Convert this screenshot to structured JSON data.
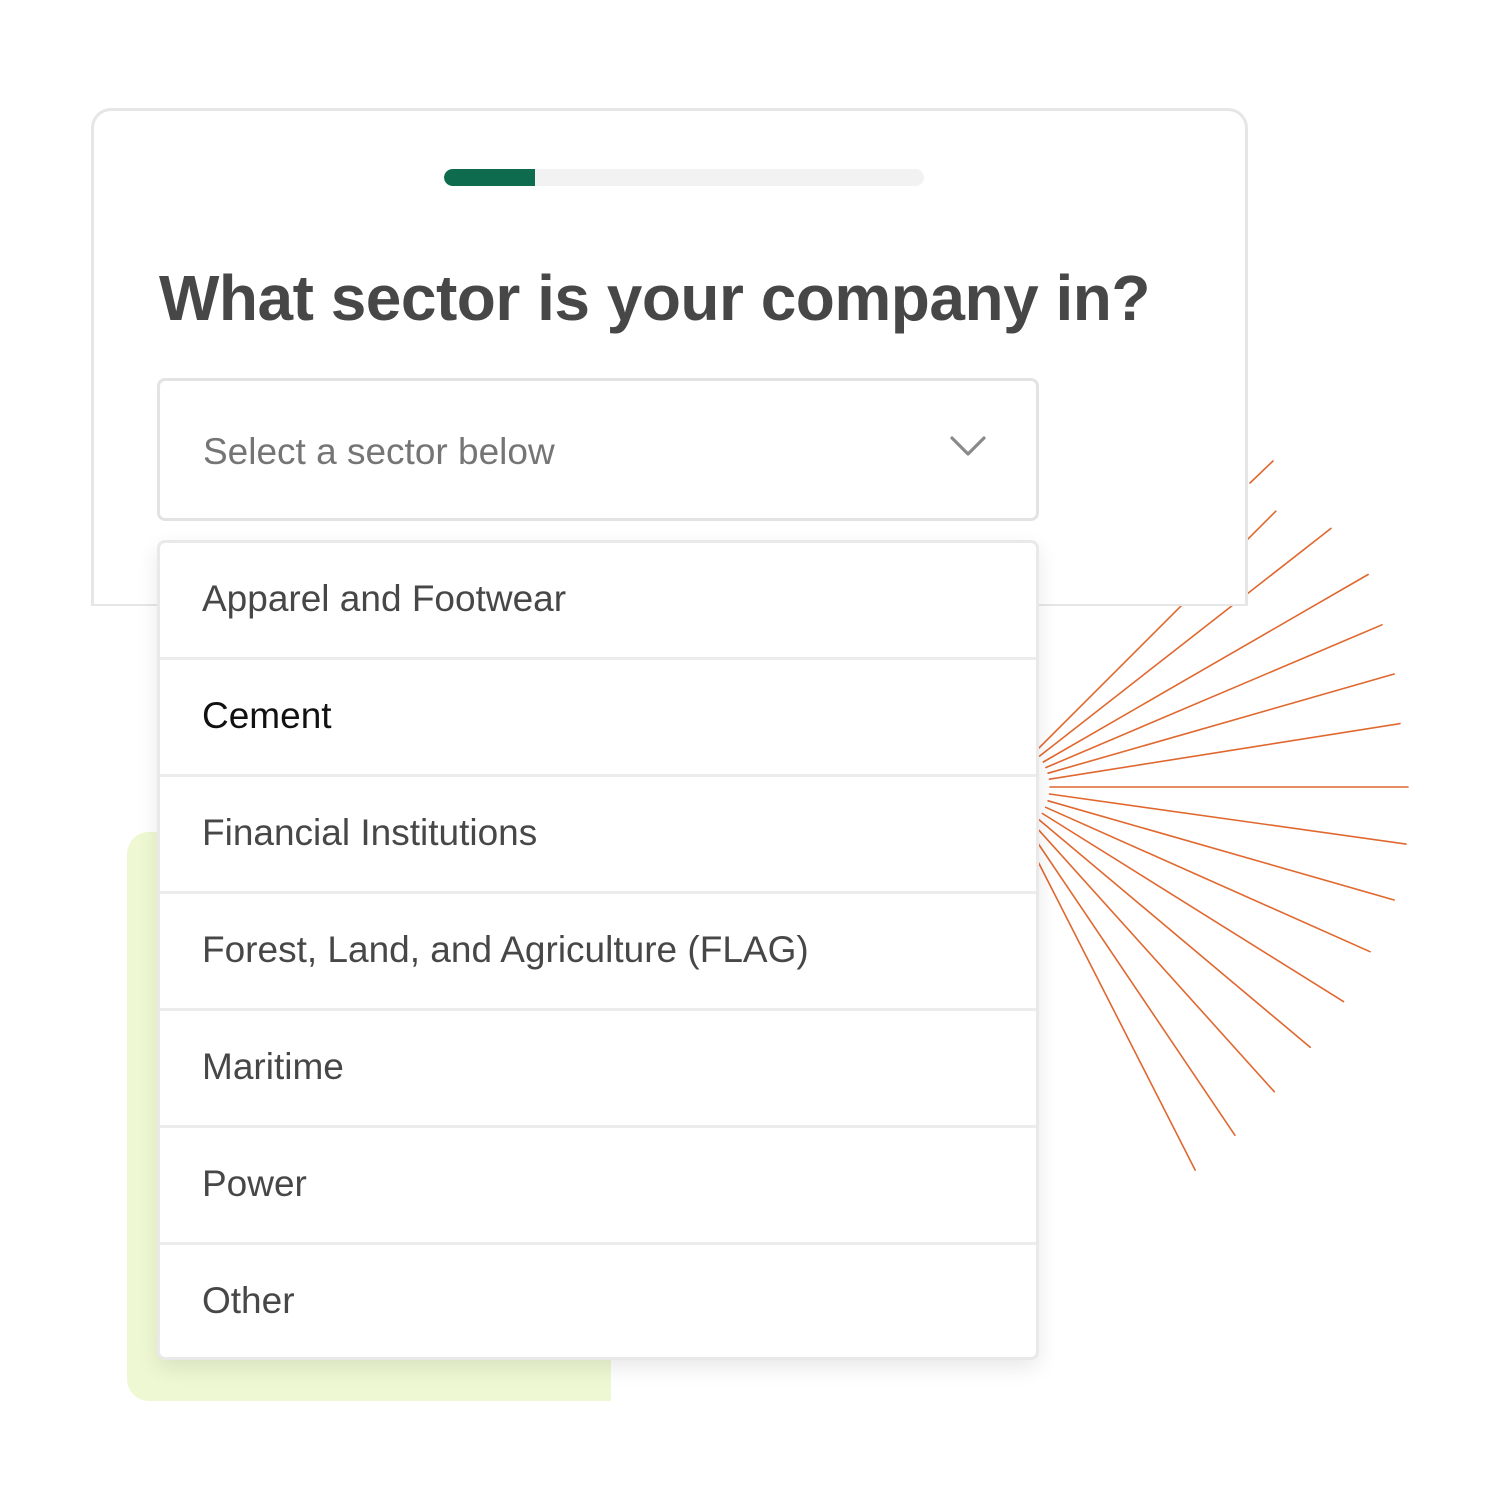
{
  "colors": {
    "accent": "#0e6b4d",
    "sunburst": "#e0682f",
    "lime_panel": "#eef8d2",
    "card_border": "#e6e6e6",
    "heading_text": "#474747",
    "placeholder_text": "#757575"
  },
  "progress": {
    "fraction": 0.19
  },
  "question": {
    "title": "What sector is your company in?"
  },
  "sector_select": {
    "placeholder": "Select a sector below",
    "icon": "chevron-down-icon",
    "expanded": true
  },
  "sector_options": [
    {
      "label": "Apparel and Footwear"
    },
    {
      "label": "Cement",
      "highlighted": true
    },
    {
      "label": "Financial Institutions"
    },
    {
      "label": "Forest, Land, and Agriculture (FLAG)"
    },
    {
      "label": "Maritime"
    },
    {
      "label": "Power"
    },
    {
      "label": "Other"
    }
  ]
}
